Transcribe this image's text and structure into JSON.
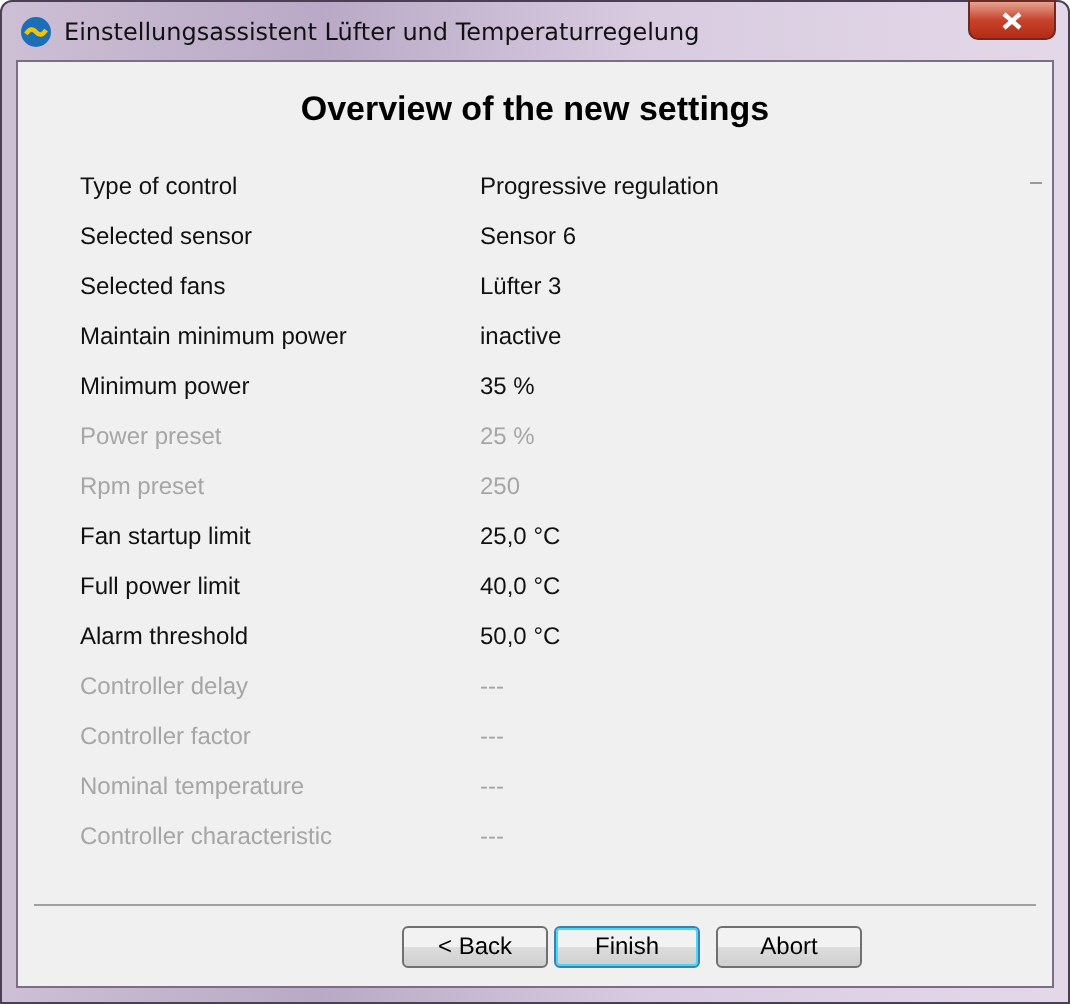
{
  "window": {
    "title": "Einstellungsassistent Lüfter und Temperaturregelung"
  },
  "heading": "Overview of the new settings",
  "rows": [
    {
      "label": "Type of control",
      "value": "Progressive regulation",
      "disabled": false
    },
    {
      "label": "Selected sensor",
      "value": "Sensor 6",
      "disabled": false
    },
    {
      "label": "Selected fans",
      "value": "Lüfter 3",
      "disabled": false
    },
    {
      "label": "Maintain minimum power",
      "value": "inactive",
      "disabled": false
    },
    {
      "label": "Minimum power",
      "value": "35 %",
      "disabled": false
    },
    {
      "label": "Power preset",
      "value": "25 %",
      "disabled": true
    },
    {
      "label": "Rpm preset",
      "value": "250",
      "disabled": true
    },
    {
      "label": "Fan startup limit",
      "value": "25,0 °C",
      "disabled": false
    },
    {
      "label": "Full power limit",
      "value": "40,0 °C",
      "disabled": false
    },
    {
      "label": "Alarm threshold",
      "value": "50,0 °C",
      "disabled": false
    },
    {
      "label": "Controller delay",
      "value": "---",
      "disabled": true
    },
    {
      "label": "Controller factor",
      "value": "---",
      "disabled": true
    },
    {
      "label": "Nominal temperature",
      "value": "---",
      "disabled": true
    },
    {
      "label": "Controller characteristic",
      "value": "---",
      "disabled": true
    }
  ],
  "buttons": [
    {
      "label": "< Back",
      "default": false
    },
    {
      "label": "Finish",
      "default": true
    },
    {
      "label": "Abort",
      "default": false
    }
  ]
}
